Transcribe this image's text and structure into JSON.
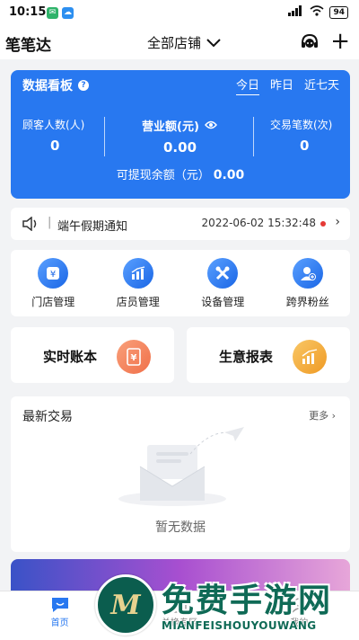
{
  "status_bar": {
    "time": "10:15",
    "network": "4G",
    "battery": "94"
  },
  "header": {
    "brand": "笔笔达",
    "store_select": "全部店铺"
  },
  "dashboard": {
    "title": "数据看板",
    "tabs": [
      {
        "label": "今日",
        "active": true
      },
      {
        "label": "昨日",
        "active": false
      },
      {
        "label": "近七天",
        "active": false
      }
    ],
    "customers": {
      "label": "顾客人数(人)",
      "value": "0"
    },
    "revenue": {
      "label": "营业额(元)",
      "value": "0.00"
    },
    "transactions": {
      "label": "交易笔数(次)",
      "value": "0"
    },
    "withdrawable": {
      "label": "可提现余额（元）",
      "value": "0.00"
    }
  },
  "notice": {
    "text": "端午假期通知",
    "datetime": "2022-06-02 15:32:48"
  },
  "menu": [
    {
      "label": "门店管理",
      "icon": "store-icon"
    },
    {
      "label": "店员管理",
      "icon": "chart-icon"
    },
    {
      "label": "设备管理",
      "icon": "tools-icon"
    },
    {
      "label": "跨界粉丝",
      "icon": "user-add-icon"
    }
  ],
  "cards": {
    "ledger": {
      "label": "实时账本",
      "icon": "ledger-icon",
      "color": "#f5875a"
    },
    "report": {
      "label": "生意报表",
      "icon": "report-icon",
      "color": "#f2a93b"
    }
  },
  "recent": {
    "title": "最新交易",
    "more": "更多",
    "empty_text": "暂无数据"
  },
  "tabbar": [
    {
      "label": "首页",
      "active": true
    },
    {
      "label": "兑换专区",
      "active": false
    },
    {
      "label": "我的",
      "active": false
    }
  ],
  "watermark": {
    "title": "免费手游网",
    "subtitle": "MIANFEISHOUYOUWANG",
    "logo_letter": "M"
  },
  "colors": {
    "primary": "#2878f0",
    "background": "#f2f3f5"
  }
}
